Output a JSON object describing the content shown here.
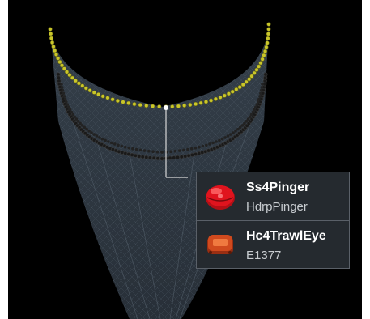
{
  "scene": {
    "background_color": "#000000",
    "net_color": "#2f3a44",
    "headline_float_color": "#c9c62a",
    "footrope_color": "#1a1a1a"
  },
  "tooltip": {
    "items": [
      {
        "name": "Ss4Pinger",
        "type": "HdrpPinger",
        "icon": "pinger-icon",
        "icon_color": "#e0141e"
      },
      {
        "name": "Hc4TrawlEye",
        "type": "E1377",
        "icon": "trawl-eye-icon",
        "icon_color": "#c8421c"
      }
    ]
  }
}
